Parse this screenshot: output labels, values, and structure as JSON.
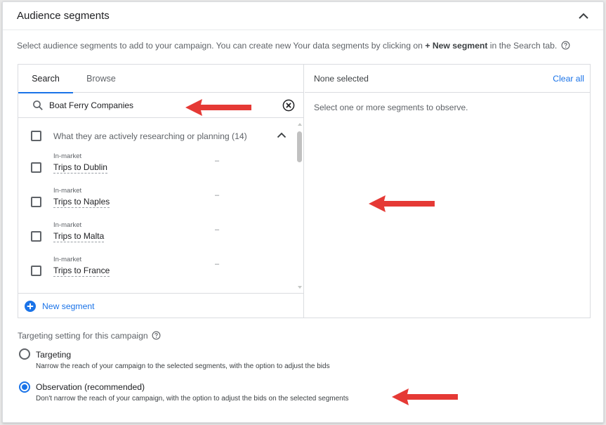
{
  "card": {
    "title": "Audience segments",
    "intro_prefix": "Select audience segments to add to your campaign. You can create new Your data segments by clicking on ",
    "intro_bold": "+ New segment",
    "intro_suffix": " in the Search tab."
  },
  "tabs": [
    {
      "label": "Search",
      "active": true
    },
    {
      "label": "Browse",
      "active": false
    }
  ],
  "search": {
    "value": "Boat Ferry Companies",
    "placeholder": ""
  },
  "group": {
    "label": "What they are actively researching or planning (14)",
    "checked": false,
    "expanded": true
  },
  "segments": [
    {
      "category": "In-market",
      "name": "Trips to Dublin",
      "value": "–"
    },
    {
      "category": "In-market",
      "name": "Trips to Naples",
      "value": "–"
    },
    {
      "category": "In-market",
      "name": "Trips to Malta",
      "value": "–"
    },
    {
      "category": "In-market",
      "name": "Trips to France",
      "value": "–"
    }
  ],
  "new_segment_label": "New segment",
  "selection": {
    "status": "None selected",
    "clear_all": "Clear all",
    "hint": "Select one or more segments to observe."
  },
  "targeting": {
    "title": "Targeting setting for this campaign",
    "options": [
      {
        "label": "Targeting",
        "description": "Narrow the reach of your campaign to the selected segments, with the option to adjust the bids",
        "selected": false
      },
      {
        "label": "Observation (recommended)",
        "description": "Don't narrow the reach of your campaign, with the option to adjust the bids on the selected segments",
        "selected": true
      }
    ]
  },
  "colors": {
    "accent": "#1a73e8",
    "annotation_arrow": "#e53935"
  },
  "icons": {
    "collapse": "chevron-up-icon",
    "help": "help-circle-icon",
    "search": "search-icon",
    "clear": "clear-circle-icon",
    "add": "add-circle-icon",
    "annotation": "arrow-left-icon"
  }
}
